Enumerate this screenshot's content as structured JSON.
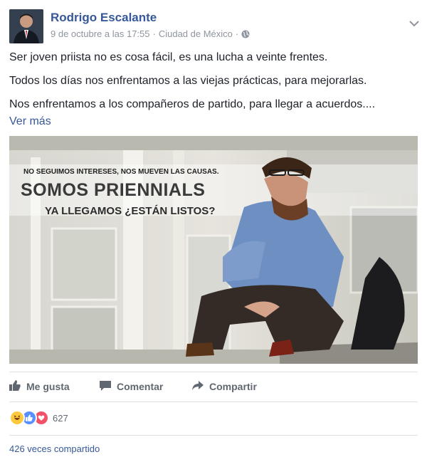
{
  "post": {
    "author": "Rodrigo Escalante",
    "date": "9 de octubre a las 17:55",
    "separator": "·",
    "location": "Ciudad de México",
    "privacy_icon": "globe-icon",
    "menu_icon": "chevron-down-icon",
    "paragraphs": [
      "Ser joven priista no es cosa fácil, es una lucha a veinte frentes.",
      "Todos los días nos enfrentamos a las viejas prácticas, para mejorarlas.",
      "Nos enfrentamos a los compañeros de partido, para llegar a acuerdos...."
    ],
    "see_more": "Ver más"
  },
  "image": {
    "line1": "NO SEGUIMOS INTERESES, NOS MUEVEN LAS CAUSAS.",
    "line2": "SOMOS PRIENNIALS",
    "line3": "YA LLEGAMOS ¿ESTÁN LISTOS?"
  },
  "actions": {
    "like": "Me gusta",
    "comment": "Comentar",
    "share": "Compartir"
  },
  "reactions": {
    "icons": [
      "haha-icon",
      "like-icon",
      "love-icon"
    ],
    "count": "627"
  },
  "shares_text": "426 veces compartido",
  "colors": {
    "link": "#365899",
    "muted": "#606770",
    "meta": "#8f959e",
    "like_blue": "#5890ff",
    "love_red": "#f25268",
    "haha_yellow": "#fcc93f"
  }
}
